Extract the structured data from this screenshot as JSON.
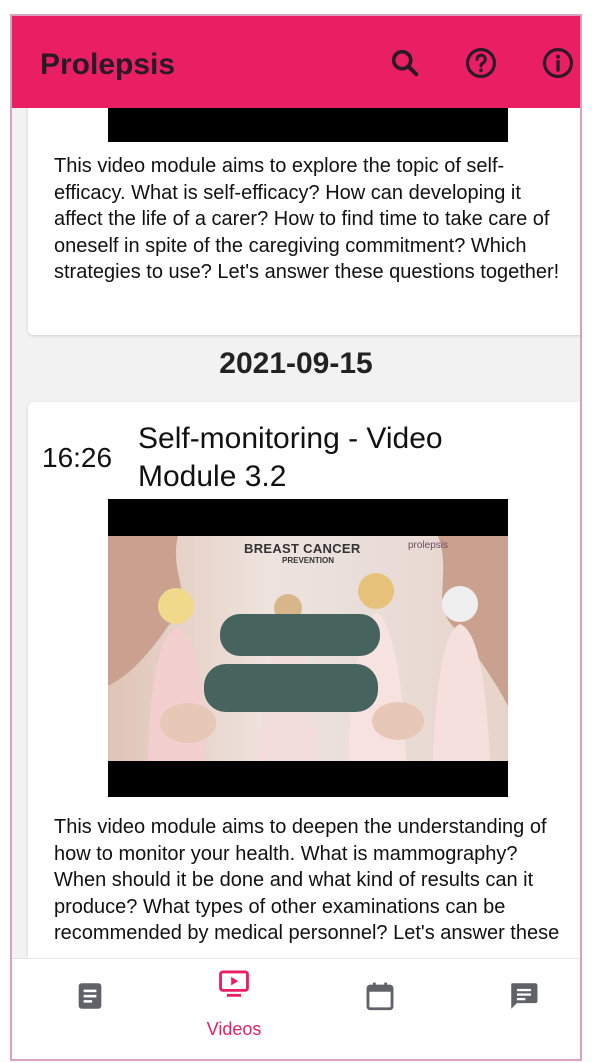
{
  "app": {
    "title": "Prolepsis",
    "accent": "#e91e63"
  },
  "cards": [
    {
      "description": "This video module aims to explore the topic of self-efficacy. What is self-efficacy? How can developing it affect the life of a carer? How to find time to take care of oneself in spite of the caregiving commitment? Which strategies to use? Let's answer these questions together!"
    },
    {
      "date": "2021-09-15",
      "time": "16:26",
      "title": "Self-monitoring - Video Module 3.2",
      "thumbnail": {
        "heading": "BREAST CANCER",
        "subheading": "PREVENTION",
        "brand": "prolepsis"
      },
      "description": "This video module aims to deepen the understanding of how to monitor your health. What is mammography? When should it be done and what kind of results can it produce? What types of other examinations can be recommended by medical personnel? Let's answer these"
    }
  ],
  "nav": {
    "items": [
      {
        "icon": "document-icon",
        "label": ""
      },
      {
        "icon": "video-icon",
        "label": "Videos"
      },
      {
        "icon": "calendar-icon",
        "label": ""
      },
      {
        "icon": "chat-icon",
        "label": ""
      }
    ]
  }
}
